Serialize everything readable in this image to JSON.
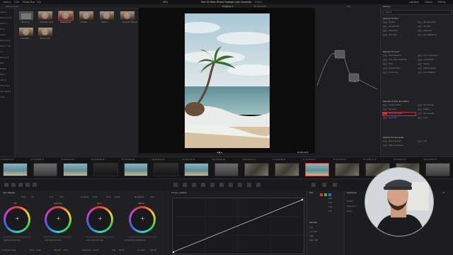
{
  "window": {
    "title": "How To Make iPhone Footage Look Cinematic",
    "edited_label": "Edited"
  },
  "top_toolbar": {
    "left_items": [
      "Gallery",
      "LUTs",
      "Media Pool",
      "Clip"
    ],
    "viewer_zoom": "30%",
    "timeline_name": "Timeline 1",
    "timecode": "00:00:00:00",
    "clip_label": "Clip",
    "right_items": [
      "Lightbox",
      "Library",
      "Effects"
    ]
  },
  "media": {
    "folder_label": "iPhone LUTs",
    "clips": [
      {
        "name": "Apple Log",
        "type": "folder"
      },
      {
        "name": "Cinematic Look",
        "type": "portrait"
      },
      {
        "name": "Cinema LUT",
        "type": "portrait"
      },
      {
        "name": "Portrait",
        "type": "portrait"
      },
      {
        "name": "Fashion",
        "type": "portrait"
      },
      {
        "name": "Cinematic Bleach",
        "type": "portrait"
      },
      {
        "name": "Cinematic",
        "type": "portrait"
      },
      {
        "name": "iPhone Look",
        "type": "portrait"
      }
    ]
  },
  "sidebar": {
    "items": [
      "Gallery",
      "Resolve LUTs",
      "DaVinci",
      "Sony",
      "Canon",
      "Blackmagic",
      "iPhone LUTs",
      "Arri",
      "Panasonic",
      "RED",
      "Fujifilm",
      "Nikon",
      "VFX IO",
      "Film Looks",
      "Astrodesign",
      "ACES"
    ]
  },
  "viewer": {
    "timecode": "01:00:14:21"
  },
  "effects_panel": {
    "tab": "Library",
    "search_placeholder": "Search",
    "sections": [
      {
        "title": "Resolve FX Blur",
        "items": [
          "Box Blur",
          "Directional Blur",
          "Gaussian Blur",
          "Lens Blur",
          "Mosaic Blur",
          "Radial Blur",
          "Zoom Blur",
          "Lens Reflections"
        ]
      },
      {
        "title": "Resolve FX Color",
        "items": [
          "ACES Transform",
          "Color Compressor",
          "Color Space Transform",
          "Contrast Pop",
          "DCTL",
          "Dehaze",
          "Gamut Limiter",
          "Gamut Mapping",
          "Invert Color",
          "Color Stabilizer"
        ]
      },
      {
        "title": "Resolve FX Film Emulation",
        "items": [
          "Camera Shake",
          "Film Damage",
          "Film Grain",
          "Film Look Creator",
          "Halation",
          "Film Vignette",
          "Cinematic",
          "Grain"
        ]
      },
      {
        "title": "Resolve FX Generate",
        "items": [
          "Color Generator",
          "Grid",
          "Pattern Generator"
        ]
      }
    ]
  },
  "timeline": {
    "clips": [
      {
        "id": "01",
        "tc": "00:00:17:07",
        "tone": "sea"
      },
      {
        "id": "02",
        "tc": "00:00:09:12",
        "tone": "grey"
      },
      {
        "id": "03",
        "tc": "00:00:23:08",
        "tone": "sea"
      },
      {
        "id": "04",
        "tc": "00:00:06:18",
        "tone": "dark"
      },
      {
        "id": "05",
        "tc": "00:00:05:04",
        "tone": "sea"
      },
      {
        "id": "06",
        "tc": "00:00:03:16",
        "tone": "dark"
      },
      {
        "id": "07",
        "tc": "00:00:10:12",
        "tone": "sea"
      },
      {
        "id": "08",
        "tc": "00:00:04:06",
        "tone": "grey"
      },
      {
        "id": "09",
        "tc": "00:00:10:12",
        "tone": "rock"
      },
      {
        "id": "10",
        "tc": "12:29:08:23",
        "tone": "rock"
      },
      {
        "id": "11",
        "tc": "10:39:49:22",
        "tone": "sea"
      },
      {
        "id": "12",
        "tc": "09:29:08:15",
        "tone": "rock"
      },
      {
        "id": "13",
        "tc": "10:38:12:10",
        "tone": "rock"
      },
      {
        "id": "14",
        "tc": "10:40:05:17",
        "tone": "rock"
      },
      {
        "id": "15",
        "tc": "10:38:52:13",
        "tone": "grey"
      }
    ],
    "active_clip": "11",
    "active_label": "H.265 Main 10 L5.1"
  },
  "color_wheels": {
    "title": "Color Wheels",
    "params": [
      {
        "label": "Temp",
        "value": "0.0"
      },
      {
        "label": "Tint",
        "value": "0.00"
      },
      {
        "label": "Contrast",
        "value": "1.000"
      },
      {
        "label": "Pivot",
        "value": "0.435"
      },
      {
        "label": "Mid/Detail",
        "value": "0.00"
      }
    ],
    "wheels": [
      {
        "name": "Lift",
        "values": [
          "0.00",
          "0.00",
          "0.00",
          "0.00"
        ]
      },
      {
        "name": "Gamma",
        "values": [
          "0.00",
          "0.00",
          "0.00",
          "0.00"
        ]
      },
      {
        "name": "Gain",
        "values": [
          "1.00",
          "1.00",
          "1.00",
          "1.00"
        ]
      },
      {
        "name": "Offset",
        "values": [
          "25.00",
          "25.00",
          "25.00",
          "25.00"
        ]
      }
    ],
    "bottom": [
      {
        "label": "Col Boost",
        "value": "0.00"
      },
      {
        "label": "Shad",
        "value": "0.00"
      },
      {
        "label": "Hi/Light",
        "value": "0.00"
      },
      {
        "label": "Saturation",
        "value": "50.00"
      },
      {
        "label": "Hue",
        "value": "50.00"
      },
      {
        "label": "Lum Mix",
        "value": "100.00"
      }
    ]
  },
  "curves": {
    "title": "Curves - Custom"
  },
  "edit_panel": {
    "title": "Edit",
    "rows": [
      {
        "label": "",
        "value": "100"
      },
      {
        "label": "",
        "value": "100"
      },
      {
        "label": "",
        "value": "100"
      },
      {
        "label": "",
        "value": "100"
      }
    ],
    "soft_clip": "Soft Clip",
    "soft_rows": [
      "Low",
      "Low Soft",
      "High",
      "High Soft"
    ]
  },
  "keyframes": {
    "title": "Keyframes",
    "tracks": [
      "Master",
      "Corrector 1",
      "Sizing"
    ],
    "mode": "All"
  },
  "colors": {
    "accent_red": "#c0392b",
    "panel": "#232325"
  }
}
